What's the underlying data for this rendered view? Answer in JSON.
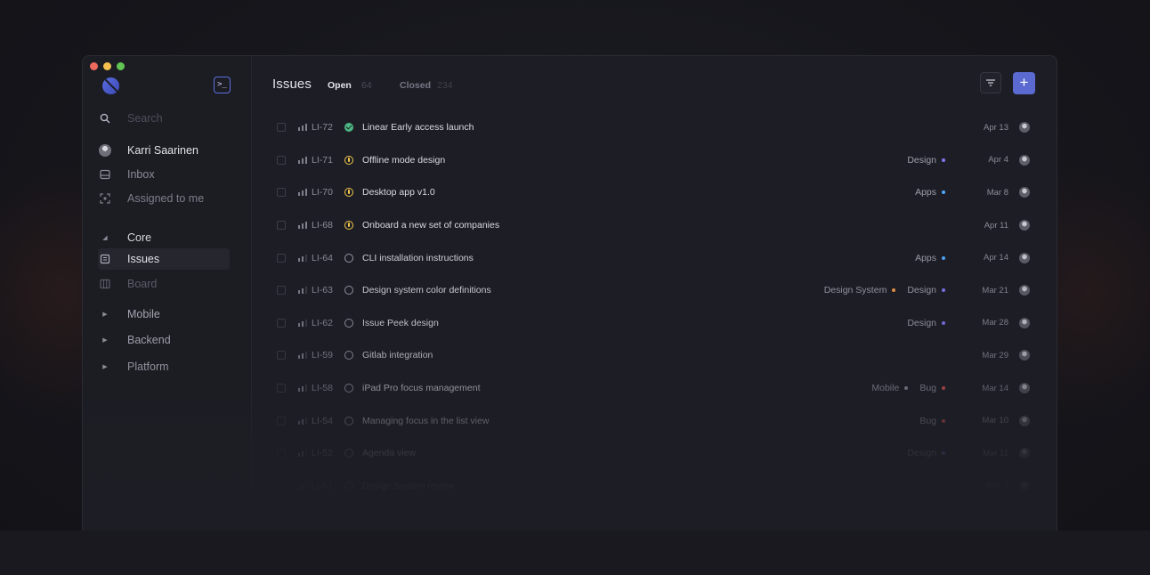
{
  "sidebar": {
    "search_placeholder": "Search",
    "user_name": "Karri Saarinen",
    "inbox": "Inbox",
    "assigned": "Assigned to me",
    "team_core": "Core",
    "issues": "Issues",
    "board": "Board",
    "team_mobile": "Mobile",
    "team_backend": "Backend",
    "team_platform": "Platform"
  },
  "header": {
    "title": "Issues",
    "tab_open": "Open",
    "open_count": "64",
    "tab_closed": "Closed",
    "closed_count": "234"
  },
  "colors": {
    "accent": "#5b6ad0",
    "status_done": "#4cb782",
    "status_in_progress": "#f2c94c",
    "label_design": "#7f77f1",
    "label_apps": "#4ea7fc",
    "label_design_system": "#f2994a",
    "label_mobile": "#9c9eaa",
    "label_bug": "#eb5757"
  },
  "issues": [
    {
      "id": "LI-72",
      "title": "Linear Early access launch",
      "status": "done",
      "priority": "high",
      "labels": [],
      "date": "Apr 13",
      "opacity": 1
    },
    {
      "id": "LI-71",
      "title": "Offline mode design",
      "status": "in-progress",
      "priority": "high",
      "labels": [
        {
          "name": "Design",
          "color": "#7f77f1"
        }
      ],
      "date": "Apr 4",
      "opacity": 1
    },
    {
      "id": "LI-70",
      "title": "Desktop app v1.0",
      "status": "in-progress",
      "priority": "high",
      "labels": [
        {
          "name": "Apps",
          "color": "#4ea7fc"
        }
      ],
      "date": "Mar 8",
      "opacity": 1
    },
    {
      "id": "LI-68",
      "title": "Onboard a new set of companies",
      "status": "in-progress",
      "priority": "high",
      "labels": [],
      "date": "Apr 11",
      "opacity": 1
    },
    {
      "id": "LI-64",
      "title": "CLI installation instructions",
      "status": "todo",
      "priority": "medium",
      "labels": [
        {
          "name": "Apps",
          "color": "#4ea7fc"
        }
      ],
      "date": "Apr 14",
      "opacity": 0.95
    },
    {
      "id": "LI-63",
      "title": "Design system color definitions",
      "status": "todo",
      "priority": "medium",
      "labels": [
        {
          "name": "Design System",
          "color": "#f2994a"
        },
        {
          "name": "Design",
          "color": "#7f77f1"
        }
      ],
      "date": "Mar 21",
      "opacity": 0.9
    },
    {
      "id": "LI-62",
      "title": "Issue Peek design",
      "status": "todo",
      "priority": "medium",
      "labels": [
        {
          "name": "Design",
          "color": "#7f77f1"
        }
      ],
      "date": "Mar 28",
      "opacity": 0.85
    },
    {
      "id": "LI-59",
      "title": "Gitlab integration",
      "status": "todo",
      "priority": "medium",
      "labels": [],
      "date": "Mar 29",
      "opacity": 0.75
    },
    {
      "id": "LI-58",
      "title": "iPad Pro focus management",
      "status": "todo",
      "priority": "medium",
      "labels": [
        {
          "name": "Mobile",
          "color": "#9c9eaa"
        },
        {
          "name": "Bug",
          "color": "#eb5757"
        }
      ],
      "date": "Mar 14",
      "opacity": 0.65
    },
    {
      "id": "LI-54",
      "title": "Managing focus in the list view",
      "status": "todo",
      "priority": "medium",
      "labels": [
        {
          "name": "Bug",
          "color": "#eb5757"
        }
      ],
      "date": "Mar 10",
      "opacity": 0.55
    },
    {
      "id": "LI-52",
      "title": "Agenda view",
      "status": "todo",
      "priority": "medium",
      "labels": [
        {
          "name": "Design",
          "color": "#7f77f1"
        }
      ],
      "date": "Mar 11",
      "opacity": 0.4
    },
    {
      "id": "LI-51",
      "title": "Design System review",
      "status": "todo",
      "priority": "medium",
      "labels": [],
      "date": "Mar 7",
      "opacity": 0.25
    }
  ]
}
